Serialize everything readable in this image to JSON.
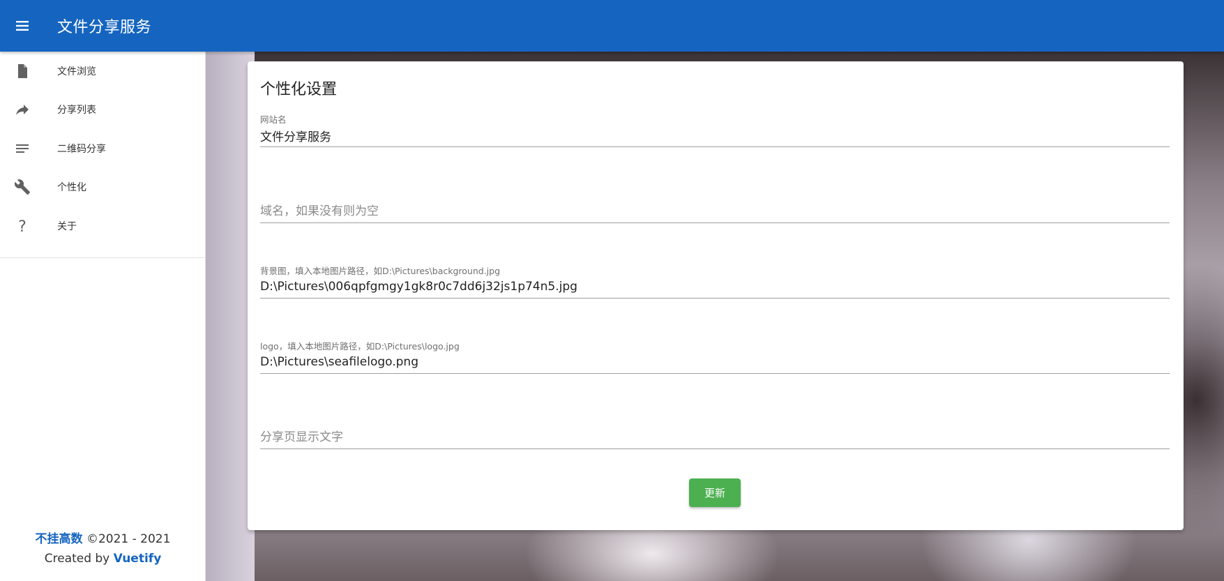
{
  "app": {
    "title": "文件分享服务",
    "accent_color": "#1565c0"
  },
  "sidebar": {
    "items": [
      {
        "label": "文件浏览",
        "icon": "file-icon"
      },
      {
        "label": "分享列表",
        "icon": "share-icon"
      },
      {
        "label": "二维码分享",
        "icon": "list-icon"
      },
      {
        "label": "个性化",
        "icon": "wrench-icon"
      },
      {
        "label": "关于",
        "icon": "help-icon"
      }
    ]
  },
  "footer": {
    "author": "不挂高数",
    "copyright": "©2021 - 2021",
    "created_by": "Created by",
    "framework": "Vuetify"
  },
  "settings": {
    "title": "个性化设置",
    "site_name": {
      "label": "网站名",
      "value": "文件分享服务"
    },
    "domain": {
      "placeholder": "域名，如果没有则为空",
      "value": ""
    },
    "background": {
      "label": "背景图，填入本地图片路径，如D:\\Pictures\\background.jpg",
      "value": "D:\\Pictures\\006qpfgmgy1gk8r0c7dd6j32js1p74n5.jpg"
    },
    "logo": {
      "label": "logo，填入本地图片路径，如D:\\Pictures\\logo.jpg",
      "value": "D:\\Pictures\\seafilelogo.png"
    },
    "share_text": {
      "placeholder": "分享页显示文字",
      "value": ""
    },
    "update_label": "更新",
    "update_color": "#4caf50"
  }
}
